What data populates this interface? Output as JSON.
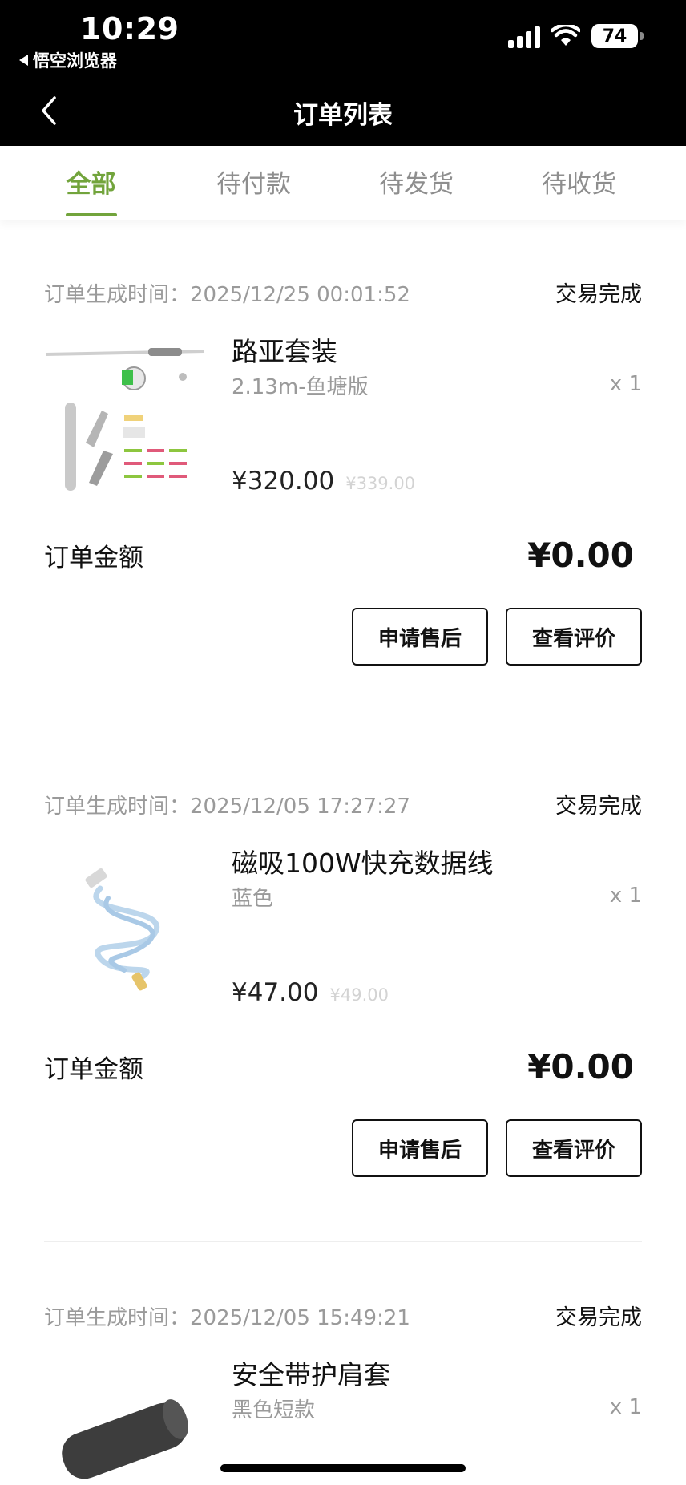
{
  "status_bar": {
    "time": "10:29",
    "back_app": "悟空浏览器",
    "battery": "74",
    "icons": [
      "signal-icon",
      "wifi-icon",
      "battery-icon"
    ]
  },
  "nav": {
    "title": "订单列表",
    "back_icon": "chevron-left-icon"
  },
  "tabs": [
    {
      "label": "全部",
      "active": true
    },
    {
      "label": "待付款",
      "active": false
    },
    {
      "label": "待发货",
      "active": false
    },
    {
      "label": "待收货",
      "active": false
    }
  ],
  "accent_color": "#72a43c",
  "orders": [
    {
      "time_label": "订单生成时间：",
      "time": "2025/12/25 00:01:52",
      "status": "交易完成",
      "item": {
        "name": "路亚套装",
        "spec": "2.13m-鱼塘版",
        "qty": "x 1",
        "price": "¥320.00",
        "original_price": "¥339.00",
        "image": "fishing-set-image"
      },
      "total_label": "订单金额",
      "total": "¥0.00",
      "buttons": [
        "申请售后",
        "查看评价"
      ]
    },
    {
      "time_label": "订单生成时间：",
      "time": "2025/12/05 17:27:27",
      "status": "交易完成",
      "item": {
        "name": "磁吸100W快充数据线",
        "spec": "蓝色",
        "qty": "x 1",
        "price": "¥47.00",
        "original_price": "¥49.00",
        "image": "usb-cable-image"
      },
      "total_label": "订单金额",
      "total": "¥0.00",
      "buttons": [
        "申请售后",
        "查看评价"
      ]
    },
    {
      "time_label": "订单生成时间：",
      "time": "2025/12/05 15:49:21",
      "status": "交易完成",
      "item": {
        "name": "安全带护肩套",
        "spec": "黑色短款",
        "qty": "x 1",
        "image": "shoulder-pad-image"
      }
    }
  ]
}
